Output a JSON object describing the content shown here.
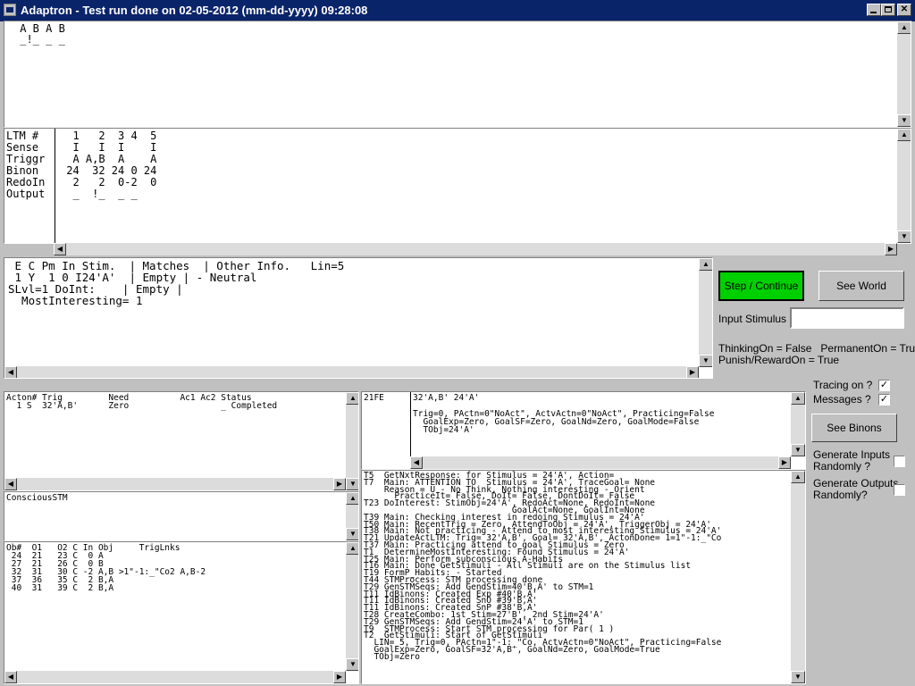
{
  "window": {
    "title": "Adaptron - Test run done on 02-05-2012 (mm-dd-yyyy) 09:28:08"
  },
  "world_view": {
    "lines": " A B A B\n _!_ _ _"
  },
  "ltm": {
    "labels": "LTM #\nSense\nTriggr\nBinon\nRedoIn\nOutput",
    "values": "  1   2  3 4  5\n  I   I  I    I\n  A A,B  A    A\n 24  32 24 0 24\n  2   2  0-2  0\n  _  !_  _ _"
  },
  "stim_panel": {
    "lines": " E C Pm In Stim.  | Matches  | Other Info.   Lin=5\n 1 Y  1 0 I24'A'  | Empty | - Neutral\nSLvl=1 DoInt:    | Empty |\n  MostInteresting= 1"
  },
  "controls": {
    "step_button": "Step / Continue",
    "see_world_button": "See World",
    "input_stimulus_label": "Input Stimulus :",
    "input_stimulus_value": "",
    "status_line1": "ThinkingOn = False   PermanentOn = True",
    "status_line2": "Punish/RewardOn = True",
    "tracing_label": "Tracing on ?",
    "tracing_checked": "✓",
    "messages_label": "Messages ?",
    "messages_checked": "✓",
    "see_binons_button": "See Binons",
    "gen_inputs_label": "Generate Inputs\nRandomly ?",
    "gen_inputs_checked": "",
    "gen_outputs_label": "Generate Outputs\nRandomly?",
    "gen_outputs_checked": ""
  },
  "action_panel": {
    "lines": "Acton# Trig         Need          Ac1 Ac2 Status\n  1 S  32'A,B'      Zero                  _ Completed"
  },
  "conscious_panel": {
    "lines": "ConsciousSTM"
  },
  "obj_panel": {
    "lines": "Ob#  O1   O2 C In Obj     TrigLnks\n 24  21   23 C  0 A\n 27  21   26 C  0 B\n 32  31   30 C -2 A,B >1\"-1:_\"Co2 A,B-2\n 37  36   35 C  2 B,A\n 40  31   39 C  2 B,A"
  },
  "fe_panel": {
    "label": "21FE",
    "lines": "32'A,B' 24'A'\n\nTrig=0, PActn=0\"NoAct\", ActvActn=0\"NoAct\", Practicing=False\n  GoalExp=Zero, GoalSF=Zero, GoalNd=Zero, GoalMode=False\n  TObj=24'A'"
  },
  "trace_panel": {
    "lines": "T5  GetNxtResponse: for Stimulus = 24'A', Action=\nT7  Main: ATTENTION TO  Stimulus = 24'A', TraceGoal= None\n    Reason = U - No Think, Nothing interesting - Orient\n      PracticeIt= False, DoIt= False, DontDoIt= False\nT23 DoInterest: StimObj=24'A', RedoAct=None, RedoInt=None\n                             GoalAct=None, GoalInt=None\nT39 Main: Checking interest in redoing Stimulus = 24'A'\nT50 Main: RecentTrig = Zero, AttendToObj = 24'A', TriggerObj = 24'A'\nT38 Main: Not practicing - Attend to most interesting Stimulus = 24'A'\nT21 UpdateActLTM: Trig= 32'A,B', Goal= 32'A,B', ActonDone= 1=1\"-1:_\"Co\nT37 Main: Practicing attend to goal Stimulus = Zero\nT1  DetermineMostInteresting: Found Stimulus = 24'A'\nT25 Main: Perform subconscious A-Habits\nT16 Main: Done GetStimuli - All Stimuli are on the Stimulus list\nT19 FormP_Habits: - Started\nT44 STMProcess: STM processing done\nT29 GenSTMSeqs: Add GendStim=40'B,A' to STM=1\nT11 IdBinons: Created Exp #40'B,A'\nT11 IdBinons: Created SnO #39'B,A'\nT11 IdBinons: Created SnP #38'B,A'\nT28 CreateCombo: 1st Stim=27'B', 2nd Stim=24'A'\nT29 GenSTMSeqs: Add GendStim=24'A' to STM=1\nT9  STMProcess: Start STM processing for Par( 1 )\nT2  GetStimuli: Start of GetStimuli\n  LIN= 5, Trig=0, PActn=1\"-1:_\"Co, ActvActn=0\"NoAct\", Practicing=False\n  GoalExp=Zero, GoalSF=32'A,B', GoalNd=Zero, GoalMode=True\n  TObj=Zero"
  }
}
